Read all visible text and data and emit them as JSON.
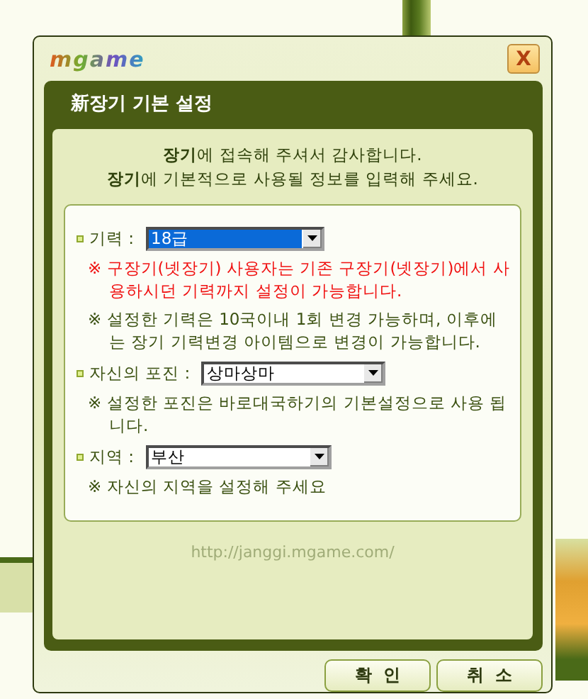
{
  "window": {
    "logo": "mgame",
    "close": "X"
  },
  "dialog": {
    "title": "新장기 기본 설정",
    "intro": [
      "**장기**에 접속해 주셔서 감사합니다.",
      "**장기**에 기본적으로 사용될 정보를 입력해 주세요."
    ],
    "fields": [
      {
        "label": "기력 :",
        "value": "18급",
        "focused": true,
        "notes": [
          {
            "text": "※ 구장기(넷장기) 사용자는 기존 구장기(넷장기)에서 사용하시던 기력까지 설정이 가능합니다.",
            "warning": true
          },
          {
            "text": "※ 설정한 기력은 10국이내 1회 변경 가능하며, 이후에는 장기 기력변경 아이템으로 변경이 가능합니다.",
            "warning": false
          }
        ]
      },
      {
        "label": "자신의 포진 :",
        "value": "상마상마",
        "focused": false,
        "notes": [
          {
            "text": "※ 설정한 포진은 바로대국하기의 기본설정으로 사용 됩니다.",
            "warning": false
          }
        ]
      },
      {
        "label": "지역 :",
        "value": "부산",
        "focused": false,
        "notes": [
          {
            "text": "※ 자신의 지역을 설정해 주세요",
            "warning": false
          }
        ]
      }
    ],
    "url": "http://janggi.mgame.com/",
    "buttons": [
      "확  인",
      "취  소"
    ]
  }
}
